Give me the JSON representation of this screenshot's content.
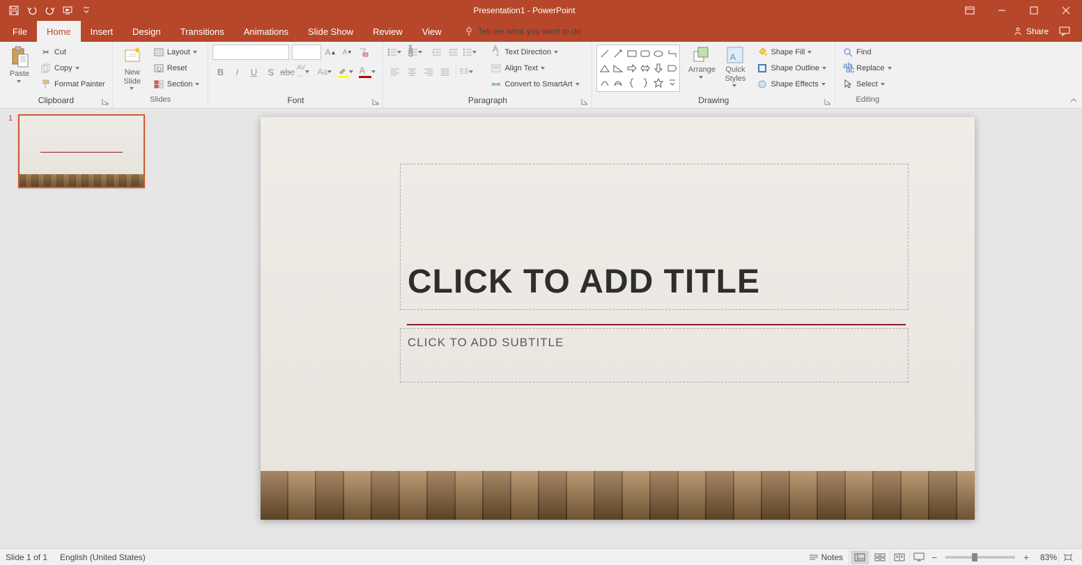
{
  "title": "Presentation1 - PowerPoint",
  "tabs": {
    "file": "File",
    "home": "Home",
    "insert": "Insert",
    "design": "Design",
    "transitions": "Transitions",
    "animations": "Animations",
    "slideshow": "Slide Show",
    "review": "Review",
    "view": "View",
    "tellme": "Tell me what you want to do",
    "share": "Share"
  },
  "ribbon": {
    "clipboard": {
      "label": "Clipboard",
      "paste": "Paste",
      "cut": "Cut",
      "copy": "Copy",
      "format_painter": "Format Painter"
    },
    "slides": {
      "label": "Slides",
      "new_slide": "New\nSlide",
      "layout": "Layout",
      "reset": "Reset",
      "section": "Section"
    },
    "font": {
      "label": "Font"
    },
    "paragraph": {
      "label": "Paragraph",
      "text_direction": "Text Direction",
      "align_text": "Align Text",
      "convert_smartart": "Convert to SmartArt"
    },
    "drawing": {
      "label": "Drawing",
      "arrange": "Arrange",
      "quick_styles": "Quick\nStyles",
      "shape_fill": "Shape Fill",
      "shape_outline": "Shape Outline",
      "shape_effects": "Shape Effects"
    },
    "editing": {
      "label": "Editing",
      "find": "Find",
      "replace": "Replace",
      "select": "Select"
    }
  },
  "slide": {
    "title_placeholder": "CLICK TO ADD TITLE",
    "subtitle_placeholder": "CLICK TO ADD SUBTITLE",
    "thumb_number": "1"
  },
  "status": {
    "slide_info": "Slide 1 of 1",
    "language": "English (United States)",
    "notes": "Notes",
    "zoom": "83%"
  }
}
